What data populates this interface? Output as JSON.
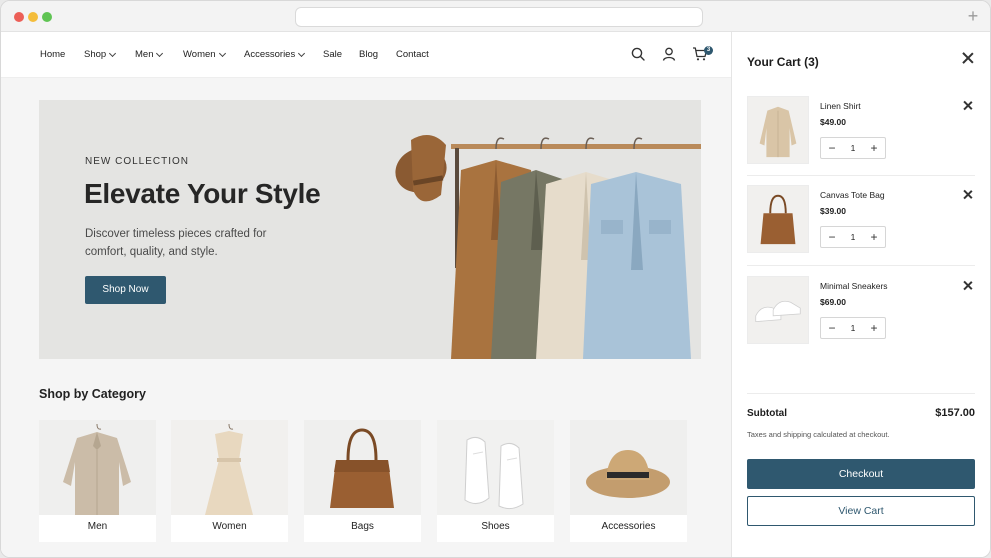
{
  "nav": {
    "items": [
      {
        "label": "Home",
        "dropdown": false
      },
      {
        "label": "Shop",
        "dropdown": true
      },
      {
        "label": "Men",
        "dropdown": true
      },
      {
        "label": "Women",
        "dropdown": true
      },
      {
        "label": "Accessories",
        "dropdown": true
      },
      {
        "label": "Sale",
        "dropdown": false
      },
      {
        "label": "Blog",
        "dropdown": false
      },
      {
        "label": "Contact",
        "dropdown": false
      }
    ],
    "cart_count": "3",
    "icons": [
      "search-icon",
      "user-icon",
      "cart-icon"
    ]
  },
  "hero": {
    "kicker": "NEW COLLECTION",
    "title": "Elevate Your Style",
    "description": "Discover timeless pieces crafted for comfort, quality, and style.",
    "button_label": "Shop Now"
  },
  "categories": {
    "heading": "Shop by Category",
    "items": [
      {
        "label": "Men"
      },
      {
        "label": "Women"
      },
      {
        "label": "Bags"
      },
      {
        "label": "Shoes"
      },
      {
        "label": "Accessories"
      }
    ]
  },
  "cart": {
    "title": "Your Cart (3)",
    "items": [
      {
        "name": "Linen Shirt",
        "price": "$49.00",
        "qty": "1"
      },
      {
        "name": "Canvas Tote Bag",
        "price": "$39.00",
        "qty": "1"
      },
      {
        "name": "Minimal Sneakers",
        "price": "$69.00",
        "qty": "1"
      }
    ],
    "subtotal_label": "Subtotal",
    "subtotal_value": "$157.00",
    "tax_note": "Taxes and shipping calculated at checkout.",
    "checkout_label": "Checkout",
    "view_cart_label": "View Cart"
  },
  "colors": {
    "accent": "#2f586f",
    "hero_bg": "#e4e4e2"
  }
}
